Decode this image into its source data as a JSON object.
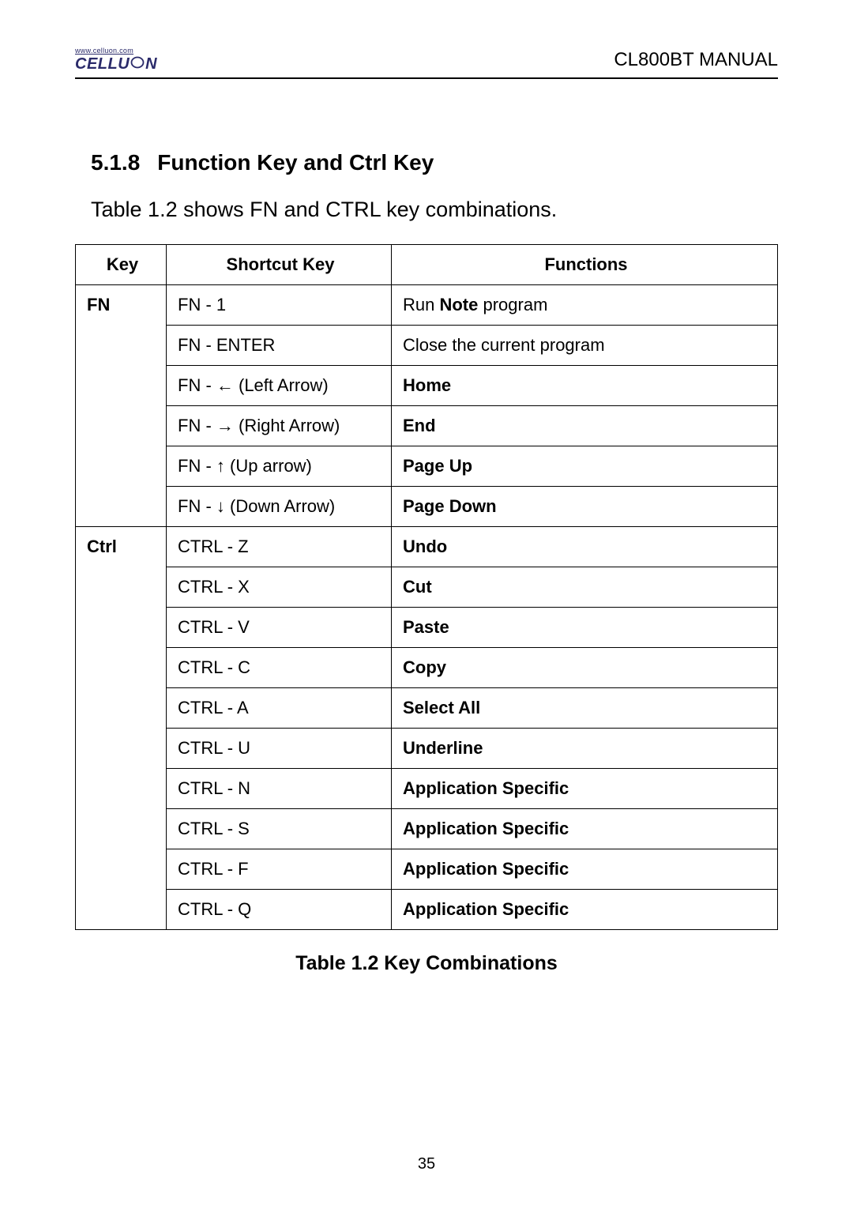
{
  "header": {
    "url": "www.celluon.com",
    "brand_left": "CELLU",
    "brand_right": "N",
    "doc_title": "CL800BT MANUAL"
  },
  "section": {
    "number": "5.1.8",
    "title": "Function Key and Ctrl Key",
    "intro": "Table 1.2 shows FN and CTRL key combinations."
  },
  "table": {
    "headers": {
      "key": "Key",
      "shortcut": "Shortcut Key",
      "functions": "Functions"
    },
    "fn": {
      "label": "FN",
      "rows": [
        {
          "shortcut": "FN - 1",
          "func_prefix": "Run ",
          "func_bold": "Note",
          "func_suffix": " program"
        },
        {
          "shortcut": "FN - ENTER",
          "func": "Close the current program"
        },
        {
          "shortcut": "FN -  ←  (Left Arrow)",
          "func_bold_only": "Home"
        },
        {
          "shortcut": "FN -  →  (Right Arrow)",
          "func_bold_only": "End"
        },
        {
          "shortcut": "FN -  ↑ (Up arrow)",
          "func_bold_only": "Page Up"
        },
        {
          "shortcut": "FN -  ↓ (Down Arrow)",
          "func_bold_only": "Page Down"
        }
      ]
    },
    "ctrl": {
      "label": "Ctrl",
      "rows": [
        {
          "shortcut": "CTRL - Z",
          "func_bold_only": "Undo"
        },
        {
          "shortcut": "CTRL - X",
          "func_bold_only": "Cut"
        },
        {
          "shortcut": "CTRL - V",
          "func_bold_only": "Paste"
        },
        {
          "shortcut": "CTRL - C",
          "func_bold_only": "Copy"
        },
        {
          "shortcut": "CTRL - A",
          "func_bold_only": "Select All"
        },
        {
          "shortcut": "CTRL - U",
          "func_bold_only": "Underline",
          "tall": true
        },
        {
          "shortcut": "CTRL - N",
          "func_bold_only": "Application Specific",
          "tall": true
        },
        {
          "shortcut": "CTRL - S",
          "func_bold_only": "Application Specific",
          "tall": true
        },
        {
          "shortcut": "CTRL - F",
          "func_bold_only": "Application Specific",
          "tall": true
        },
        {
          "shortcut": "CTRL - Q",
          "func_bold_only": "Application Specific",
          "tall": true
        }
      ]
    },
    "caption": "Table 1.2 Key Combinations"
  },
  "page_number": "35"
}
